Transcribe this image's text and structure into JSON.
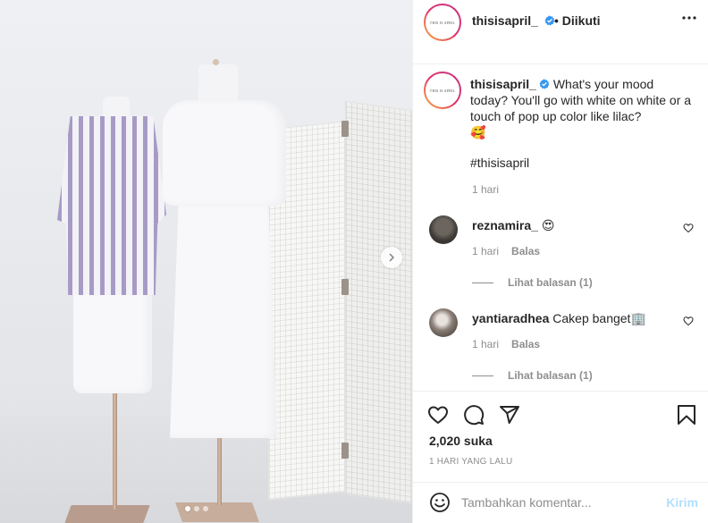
{
  "post": {
    "username": "thisisapril_",
    "avatar_text": "THIS IS APRIL",
    "follow_separator": "•",
    "follow_label": "Diikuti",
    "caption_text": "What's your mood today? You'll go with white on white or a touch of pop up color like lilac?",
    "caption_emoji": "🥰",
    "hashtag": "#thisisapril",
    "caption_time": "1 hari",
    "likes": "2,020 suka",
    "posted_time": "1 HARI YANG LALU"
  },
  "carousel": {
    "slide_count": 3,
    "active_index": 0
  },
  "comments": [
    {
      "username": "reznamira_",
      "text": "😍",
      "time": "1 hari",
      "reply_label": "Balas",
      "view_replies": "Lihat balasan (1)"
    },
    {
      "username": "yantiaradhea",
      "text": "Cakep banget🏢",
      "time": "1 hari",
      "reply_label": "Balas",
      "view_replies": "Lihat balasan (1)"
    }
  ],
  "comment_box": {
    "placeholder": "Tambahkan komentar...",
    "post_label": "Kirim"
  },
  "icons": {
    "more": "more-options-icon",
    "verified": "verified-badge-icon",
    "like": "heart-icon",
    "comment": "comment-icon",
    "share": "share-icon",
    "save": "bookmark-icon",
    "emoji": "emoji-icon",
    "next": "chevron-right-icon"
  },
  "colors": {
    "verified": "#3897f0",
    "post_button_disabled": "#b2dffc",
    "text_primary": "#262626",
    "text_secondary": "#8e8e8e",
    "stripe": "#a79bc6"
  }
}
